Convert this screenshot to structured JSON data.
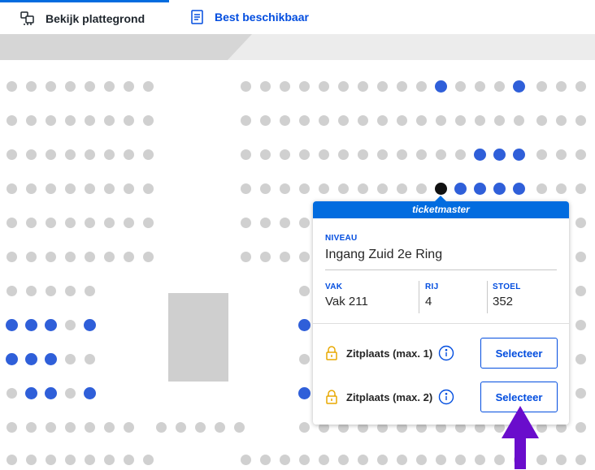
{
  "tabs": [
    {
      "label": "Bekijk plattegrond",
      "icon": "seat-map-icon",
      "active": true
    },
    {
      "label": "Best beschikbaar",
      "icon": "list-document-icon",
      "active": false
    }
  ],
  "popup": {
    "brand": "ticketmaster",
    "level_label": "NIVEAU",
    "level_value": "Ingang Zuid 2e Ring",
    "section_label": "VAK",
    "section_value": "Vak 211",
    "row_label": "RIJ",
    "row_value": "4",
    "seat_label": "STOEL",
    "seat_value": "352",
    "options": [
      {
        "label": "Zitplaats (max. 1)",
        "button": "Selecteer"
      },
      {
        "label": "Zitplaats (max. 2)",
        "button": "Selecteer"
      }
    ]
  },
  "colors": {
    "brand_blue": "#026cdf",
    "link_blue": "#024ddf",
    "available_seat": "#2f5fd9",
    "unavailable_seat": "#d0d0d0",
    "selected_seat": "#111111",
    "lock_icon": "#e8a800",
    "annotation_arrow": "#6a0dcc"
  }
}
